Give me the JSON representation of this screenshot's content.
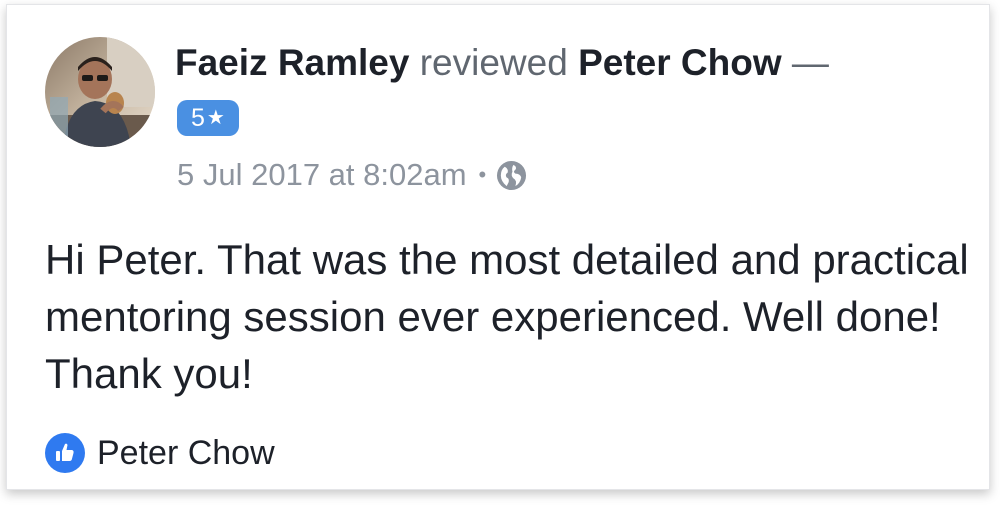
{
  "review": {
    "reviewer_name": "Faeiz Ramley",
    "action": "reviewed",
    "page_name": "Peter Chow",
    "dash": "—",
    "rating_value": "5",
    "rating_star": "★",
    "timestamp": "5 Jul 2017 at 8:02am",
    "separator": "•",
    "privacy_icon": "globe-icon",
    "text": "Hi Peter. That was the most detailed and practical mentoring session ever experienced. Well done! Thank you!"
  },
  "footer": {
    "like_icon": "thumbs-up-icon",
    "liker_name": "Peter Chow"
  },
  "colors": {
    "rating_badge": "#4a90e2",
    "like_badge": "#2f7af0",
    "secondary_text": "#8d949e",
    "primary_text": "#1d2129"
  }
}
